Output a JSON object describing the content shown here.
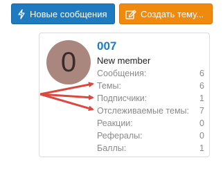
{
  "toolbar": {
    "new_messages_label": "Новые сообщения",
    "create_thread_label": "Создать тему..."
  },
  "profile": {
    "avatar_letter": "0",
    "username": "007",
    "user_title": "New member",
    "stats": [
      {
        "label": "Сообщения:",
        "value": "6"
      },
      {
        "label": "Темы:",
        "value": "6"
      },
      {
        "label": "Подписчики:",
        "value": "1"
      },
      {
        "label": "Отслеживаемые темы:",
        "value": "7"
      },
      {
        "label": "Реакции:",
        "value": "0"
      },
      {
        "label": "Рефералы:",
        "value": "0"
      },
      {
        "label": "Баллы:",
        "value": "1"
      }
    ]
  },
  "colors": {
    "primary_button": "#1f7bbf",
    "accent_button": "#ef8a0f",
    "username": "#1f7bbf",
    "avatar": "#a9877f",
    "annotation_arrows": "#d9493f"
  },
  "icons": {
    "new_messages": "bolt-icon",
    "create_thread": "edit-icon"
  }
}
